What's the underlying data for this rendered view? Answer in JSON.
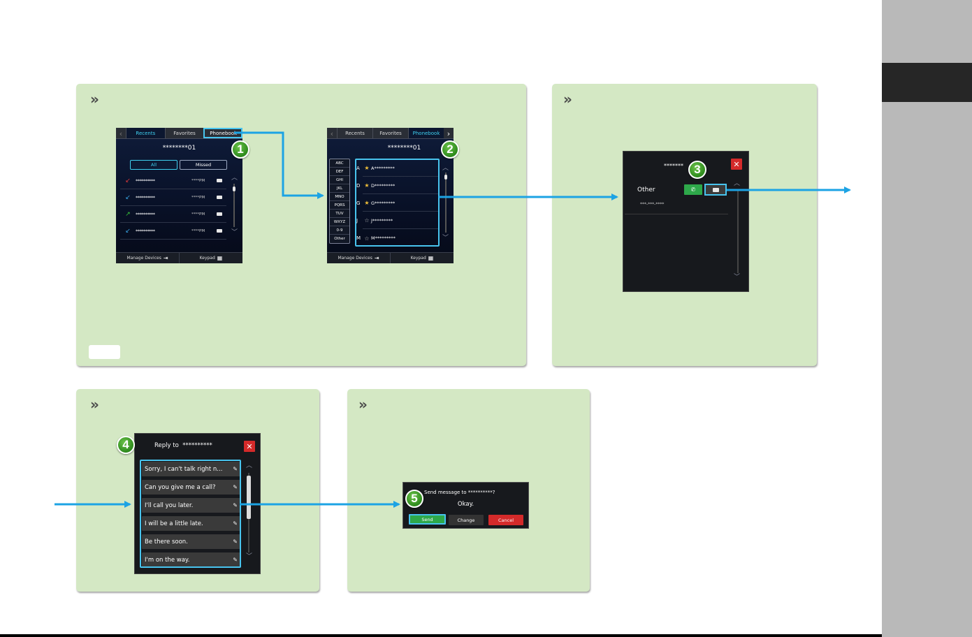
{
  "colors": {
    "panel_bg": "#d4e8c4",
    "arrow": "#1ca3e4",
    "highlight": "#48c4ee",
    "badge": "#3a9a2a",
    "sidebar": "#b9b9b9",
    "sidebar_dark": "#262626",
    "cancel_red": "#d42a2a",
    "send_green": "#2ea84a"
  },
  "panels": {
    "chevron": "»"
  },
  "screen1": {
    "tabs": [
      "Recents",
      "Favorites",
      "Phonebook"
    ],
    "contact": "********01",
    "filters": [
      "All",
      "Missed"
    ],
    "rows": [
      {
        "icon": "missed-call-icon",
        "glyph": "↙",
        "name": "**********",
        "time": "****PM"
      },
      {
        "icon": "incoming-call-icon",
        "glyph": "↙",
        "name": "**********",
        "time": "****PM"
      },
      {
        "icon": "outgoing-call-icon",
        "glyph": "↗",
        "name": "**********",
        "time": "****PM"
      },
      {
        "icon": "incoming-call-icon",
        "glyph": "↙",
        "name": "**********",
        "time": "****PM"
      }
    ],
    "bottom": {
      "manage": "Manage Devices",
      "keypad": "Keypad"
    },
    "badge": "1"
  },
  "screen2": {
    "tabs": [
      "Recents",
      "Favorites",
      "Phonebook"
    ],
    "contact": "********01",
    "index": [
      "ABC",
      "DEF",
      "GHI",
      "JKL",
      "MNO",
      "PQRS",
      "TUV",
      "WXYZ",
      "0-9",
      "Other"
    ],
    "rows": [
      {
        "letter": "A",
        "starred": true,
        "name": "A*********"
      },
      {
        "letter": "D",
        "starred": true,
        "name": "D*********"
      },
      {
        "letter": "G",
        "starred": true,
        "name": "G*********"
      },
      {
        "letter": "J",
        "starred": false,
        "name": "J*********"
      },
      {
        "letter": "M",
        "starred": false,
        "name": "M*********"
      }
    ],
    "bottom": {
      "manage": "Manage Devices",
      "keypad": "Keypad"
    },
    "badge": "2"
  },
  "screen3": {
    "title": "*******",
    "label": "Other",
    "number": "***-***-****",
    "badge": "3"
  },
  "screen4": {
    "title": "Reply to",
    "title_name": "**********",
    "items": [
      "Sorry, I can't talk right n...",
      "Can you give me a call?",
      "I'll call you later.",
      "I will be a little late.",
      "Be there soon.",
      "I'm on the way."
    ],
    "badge": "4"
  },
  "screen5": {
    "prompt": "Send message to **********?",
    "message": "Okay.",
    "buttons": {
      "send": "Send",
      "change": "Change",
      "cancel": "Cancel"
    },
    "badge": "5"
  }
}
